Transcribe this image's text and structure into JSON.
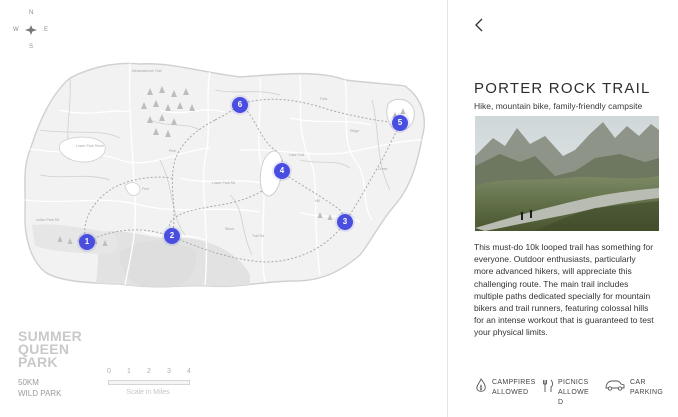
{
  "compass": {
    "n": "N",
    "s": "S",
    "e": "E",
    "w": "W"
  },
  "map": {
    "labels": [
      "Meadowbrook Trail",
      "Lower Park Shore",
      "Pine",
      "Lower Park Rd",
      "Fern",
      "Indian Park Rd",
      "Lake Trail",
      "Falls",
      "Ridge",
      "Trail Rd",
      "Creek",
      "Hill",
      "Wood"
    ],
    "markers": [
      "1",
      "2",
      "3",
      "4",
      "5",
      "6"
    ]
  },
  "park": {
    "name_line1": "SUMMER",
    "name_line2": "QUEEN",
    "name_line3": "PARK",
    "distance": "50KM",
    "type": "WILD PARK"
  },
  "scale": {
    "ticks": [
      "0",
      "1",
      "2",
      "3",
      "4"
    ],
    "caption": "Scale in Miles"
  },
  "detail": {
    "title": "PORTER ROCK TRAIL",
    "subtitle": "Hike, mountain bike, family-friendly campsite",
    "description": "This must-do 10k looped trail has something for everyone. Outdoor enthusiasts, particularly more advanced hikers, will appreciate this challenging route. The main trail includes multiple paths dedicated specially for mountain bikers and trail runners, featuring colossal hills for an intense workout that is guaranteed to test your physical limits."
  },
  "amenities": [
    {
      "icon": "campfire-icon",
      "line1": "CAMPFIRES",
      "line2": "ALLOWED"
    },
    {
      "icon": "picnic-icon",
      "line1": "PICNICS",
      "line2": "ALLOWE",
      "line3": "D"
    },
    {
      "icon": "car-icon",
      "line1": "CAR",
      "line2": "PARKING"
    }
  ],
  "colors": {
    "accent": "#4a4ee0",
    "map_fill": "#f1f1f1",
    "map_stroke": "#d2d2d2"
  }
}
